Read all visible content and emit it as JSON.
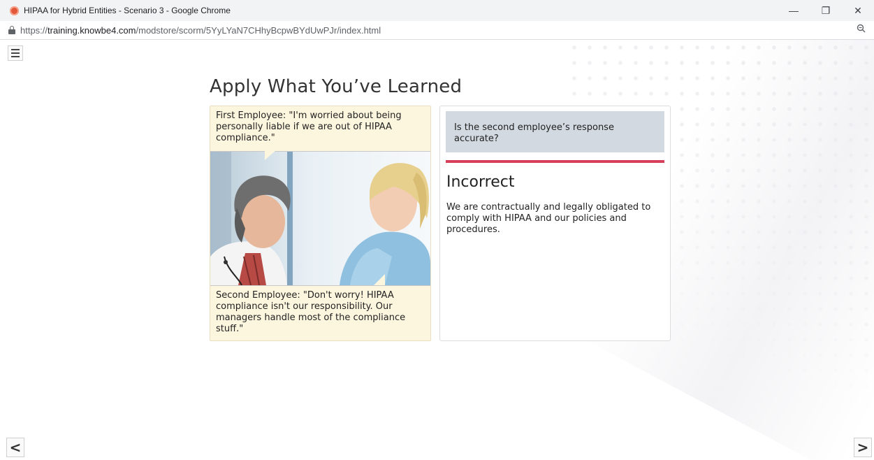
{
  "window": {
    "title": "HIPAA for Hybrid Entities - Scenario 3 - Google Chrome",
    "minimize": "—",
    "restore": "❐",
    "close": "✕"
  },
  "address": {
    "prefix": "https://",
    "domain": "training.knowbe4.com",
    "path": "/modstore/scorm/5YyLYaN7CHhyBcpwBYdUwPJr/index.html"
  },
  "page": {
    "heading": "Apply What You’ve Learned"
  },
  "scenario": {
    "first_employee": "First Employee: \"I'm worried about being personally liable if we are out of HIPAA compliance.\"",
    "second_employee": "Second Employee: \"Don't worry! HIPAA compliance isn't our responsibility. Our managers handle most of the compliance stuff.\""
  },
  "feedback": {
    "question": "Is the second employee’s response accurate?",
    "result": "Incorrect",
    "explanation": "We are contractually and legally obligated to comply with HIPAA and our policies and procedures.",
    "accent_color": "#d6405a"
  },
  "nav": {
    "prev": "<",
    "next": ">"
  }
}
